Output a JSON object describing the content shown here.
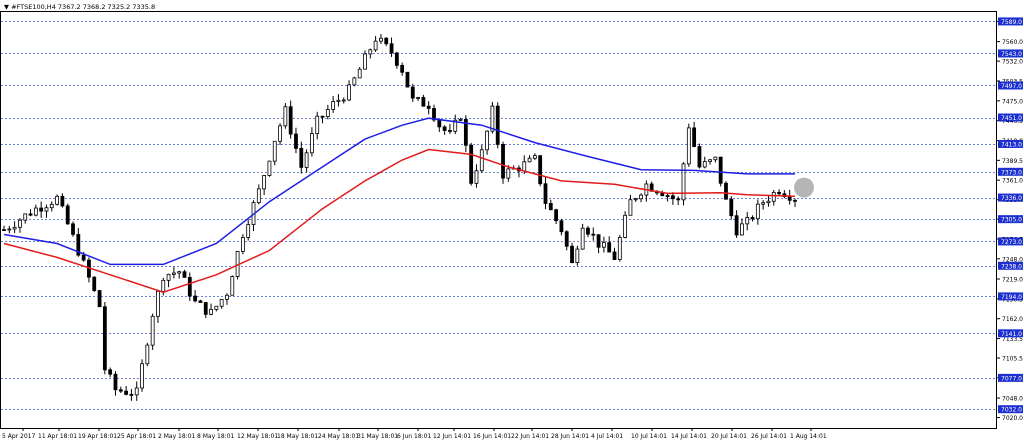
{
  "chart_data": {
    "type": "candlestick",
    "symbol_label": "▼ #FTSE100,H4",
    "ohlc_readout": "7367.2 7368.2 7325.2 7335.8",
    "ylim": [
      7005,
      7604
    ],
    "y_ticks": [
      "7589.0",
      "7560.0",
      "7532.0",
      "7503.5",
      "7475.0",
      "7446.5",
      "7418.0",
      "7389.5",
      "7361.0",
      "7333.0",
      "7305.0",
      "7276.5",
      "7248.0",
      "7219.0",
      "7190.5",
      "7162.0",
      "7133.5",
      "7105.5",
      "7077.0",
      "7048.0",
      "7020.0"
    ],
    "levels": [
      "7589.0",
      "7543.0",
      "7497.0",
      "7451.0",
      "7413.0",
      "7373.0",
      "7336.0",
      "7305.0",
      "7273.0",
      "7238.0",
      "7194.0",
      "7141.0",
      "7077.0",
      "7032.0"
    ],
    "x_labels": [
      "5 Apr 2017",
      "11 Apr 18:01",
      "19 Apr 18:01",
      "25 Apr 18:01",
      "2 May 18:01",
      "8 May 18:01",
      "12 May 18:01",
      "18 May 18:01",
      "24 May 18:01",
      "31 May 18:01",
      "6 Jun 18:01",
      "12 Jun 14:01",
      "16 Jun 14:01",
      "22 Jun 14:01",
      "28 Jun 14:01",
      "4 Jul 14:01",
      "10 Jul 14:01",
      "14 Jul 14:01",
      "20 Jul 14:01",
      "26 Jul 14:01",
      "1 Aug 14:01"
    ],
    "candle_count": 150,
    "close_path": [
      [
        0,
        7290
      ],
      [
        6,
        7320
      ],
      [
        10,
        7335
      ],
      [
        14,
        7260
      ],
      [
        18,
        7180
      ],
      [
        19,
        7090
      ],
      [
        21,
        7060
      ],
      [
        25,
        7055
      ],
      [
        28,
        7170
      ],
      [
        30,
        7225
      ],
      [
        33,
        7230
      ],
      [
        36,
        7185
      ],
      [
        39,
        7170
      ],
      [
        42,
        7200
      ],
      [
        45,
        7285
      ],
      [
        48,
        7345
      ],
      [
        51,
        7420
      ],
      [
        53,
        7460
      ],
      [
        56,
        7380
      ],
      [
        59,
        7445
      ],
      [
        62,
        7470
      ],
      [
        65,
        7490
      ],
      [
        68,
        7535
      ],
      [
        70,
        7565
      ],
      [
        73,
        7545
      ],
      [
        75,
        7520
      ],
      [
        77,
        7475
      ],
      [
        80,
        7470
      ],
      [
        82,
        7440
      ],
      [
        84,
        7425
      ],
      [
        86,
        7455
      ],
      [
        88,
        7360
      ],
      [
        90,
        7400
      ],
      [
        92,
        7460
      ],
      [
        94,
        7370
      ],
      [
        97,
        7380
      ],
      [
        100,
        7390
      ],
      [
        102,
        7330
      ],
      [
        105,
        7290
      ],
      [
        107,
        7240
      ],
      [
        109,
        7300
      ],
      [
        112,
        7270
      ],
      [
        115,
        7250
      ],
      [
        118,
        7330
      ],
      [
        121,
        7355
      ],
      [
        124,
        7345
      ],
      [
        127,
        7330
      ],
      [
        129,
        7440
      ],
      [
        131,
        7380
      ],
      [
        134,
        7390
      ],
      [
        136,
        7330
      ],
      [
        138,
        7290
      ],
      [
        140,
        7300
      ],
      [
        143,
        7330
      ],
      [
        146,
        7348
      ],
      [
        149,
        7336
      ]
    ],
    "series": [
      {
        "name": "",
        "color": "#1f1fe6",
        "values": [
          [
            0,
            7283
          ],
          [
            10,
            7270
          ],
          [
            20,
            7240
          ],
          [
            30,
            7240
          ],
          [
            40,
            7270
          ],
          [
            50,
            7330
          ],
          [
            60,
            7380
          ],
          [
            68,
            7420
          ],
          [
            75,
            7440
          ],
          [
            80,
            7450
          ],
          [
            90,
            7440
          ],
          [
            100,
            7415
          ],
          [
            110,
            7395
          ],
          [
            120,
            7376
          ],
          [
            130,
            7375
          ],
          [
            140,
            7370
          ],
          [
            149,
            7370
          ]
        ]
      },
      {
        "name": "",
        "color": "#e31a1a",
        "values": [
          [
            0,
            7270
          ],
          [
            10,
            7250
          ],
          [
            20,
            7225
          ],
          [
            30,
            7200
          ],
          [
            40,
            7225
          ],
          [
            50,
            7260
          ],
          [
            60,
            7320
          ],
          [
            68,
            7360
          ],
          [
            75,
            7390
          ],
          [
            80,
            7405
          ],
          [
            88,
            7398
          ],
          [
            95,
            7380
          ],
          [
            105,
            7360
          ],
          [
            115,
            7355
          ],
          [
            125,
            7342
          ],
          [
            135,
            7343
          ],
          [
            140,
            7340
          ],
          [
            149,
            7338
          ]
        ]
      }
    ],
    "colors": {
      "grid": "#6a7fd8",
      "label_box": "#1c30d0",
      "axis": "#000000"
    }
  }
}
